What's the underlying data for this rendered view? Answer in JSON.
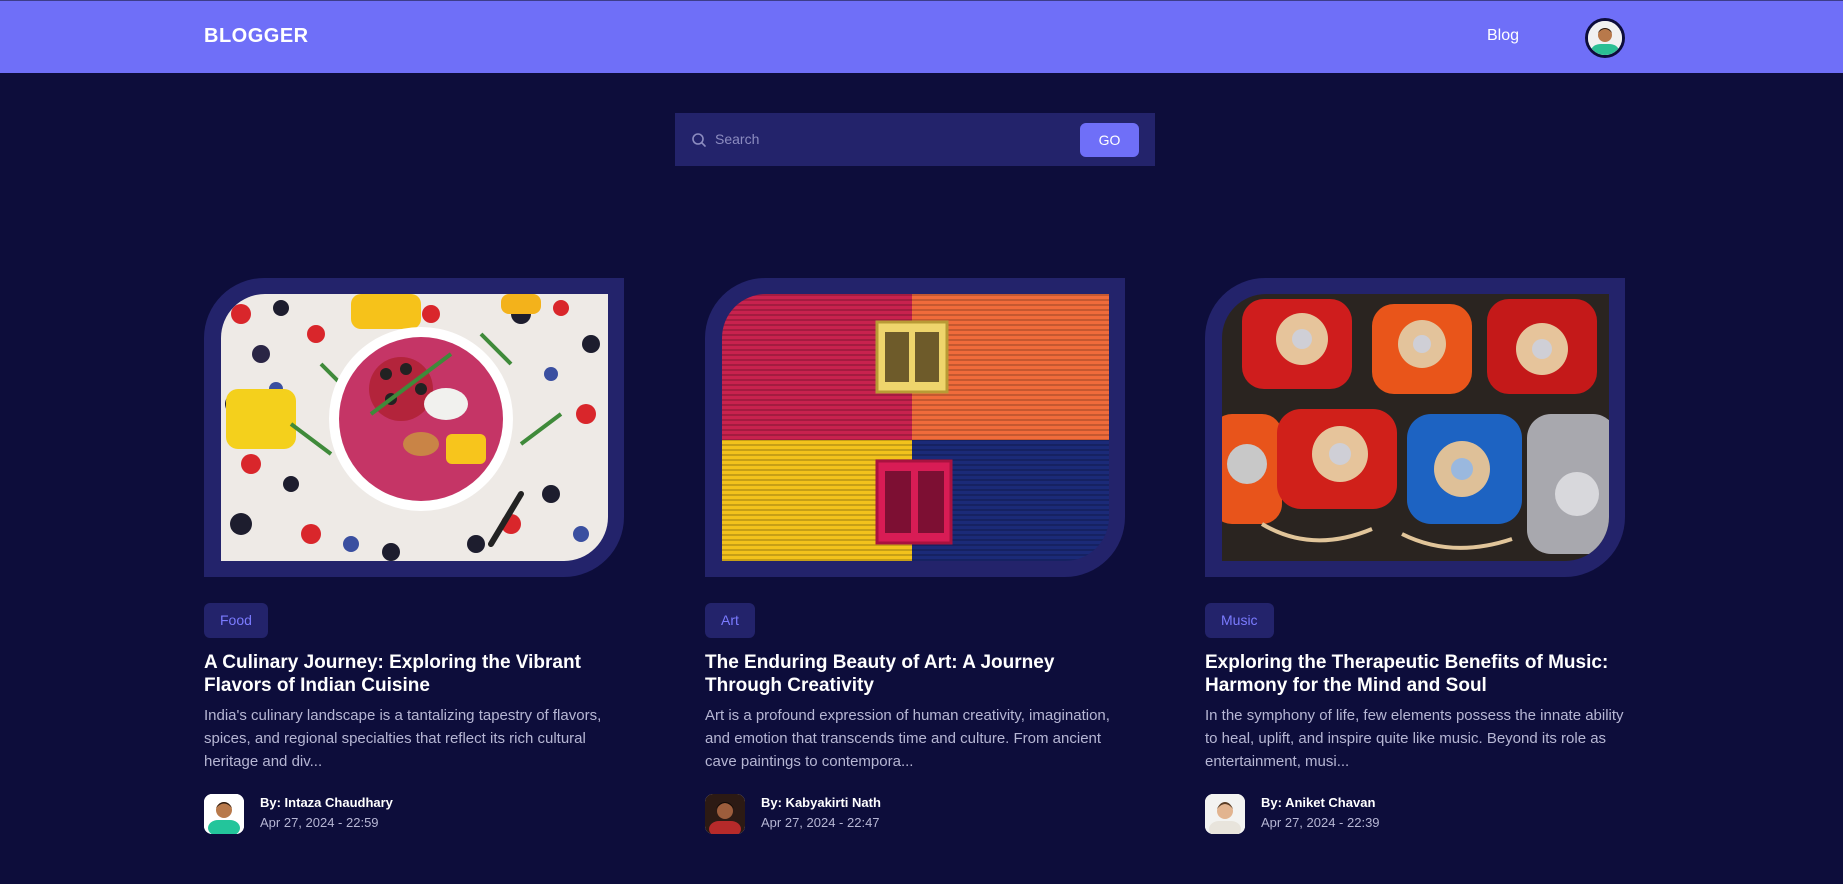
{
  "header": {
    "brand": "BLOGGER",
    "nav_link": "Blog",
    "accent_color": "#6f6ff8",
    "background_color": "#0d0d3b"
  },
  "search": {
    "placeholder": "Search",
    "value": "",
    "button_label": "GO",
    "icon": "search-icon"
  },
  "posts": [
    {
      "tag": "Food",
      "title": "A Culinary Journey: Exploring the Vibrant Flavors of Indian Cuisine",
      "excerpt": "India's culinary landscape is a tantalizing tapestry of flavors, spices, and regional specialties that reflect its rich cultural heritage and div...",
      "author": "By: Intaza Chaudhary",
      "date": "Apr 27, 2024 - 22:59"
    },
    {
      "tag": "Art",
      "title": "The Enduring Beauty of Art: A Journey Through Creativity",
      "excerpt": "Art is a profound expression of human creativity, imagination, and emotion that transcends time and culture. From ancient cave paintings to contempora...",
      "author": "By: Kabyakirti Nath",
      "date": "Apr 27, 2024 - 22:47"
    },
    {
      "tag": "Music",
      "title": "Exploring the Therapeutic Benefits of Music: Harmony for the Mind and Soul",
      "excerpt": "In the symphony of life, few elements possess the innate ability to heal, uplift, and inspire quite like music. Beyond its role as entertainment, musi...",
      "author": "By: Aniket Chavan",
      "date": "Apr 27, 2024 - 22:39"
    }
  ]
}
